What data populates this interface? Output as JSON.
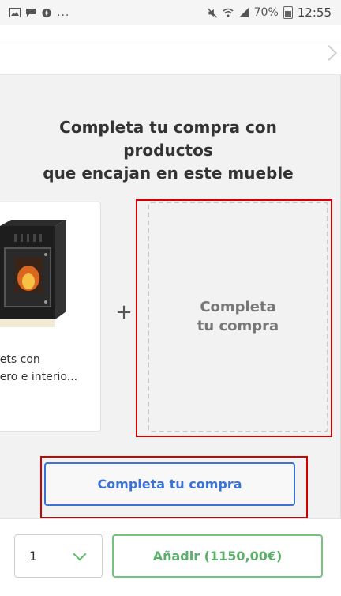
{
  "status_bar": {
    "left_icons": [
      "image-icon",
      "chat-icon",
      "compass-icon"
    ],
    "ellipsis": "...",
    "battery": "70%",
    "time": "12:55"
  },
  "section": {
    "heading_line1": "Completa tu compra con productos",
    "heading_line2": "que encajan en este mueble"
  },
  "product": {
    "name_line1": "llets con",
    "name_line2": "cero e interio..."
  },
  "plus_symbol": "+",
  "complete_box": {
    "line1": "Completa",
    "line2": "tu compra"
  },
  "cta": {
    "label": "Completa tu compra"
  },
  "bottom": {
    "quantity": "1",
    "add_label": "Añadir (1150,00€)"
  },
  "colors": {
    "accent_blue": "#3a73d6",
    "accent_green": "#5baf6a",
    "highlight_red": "#d40000"
  }
}
